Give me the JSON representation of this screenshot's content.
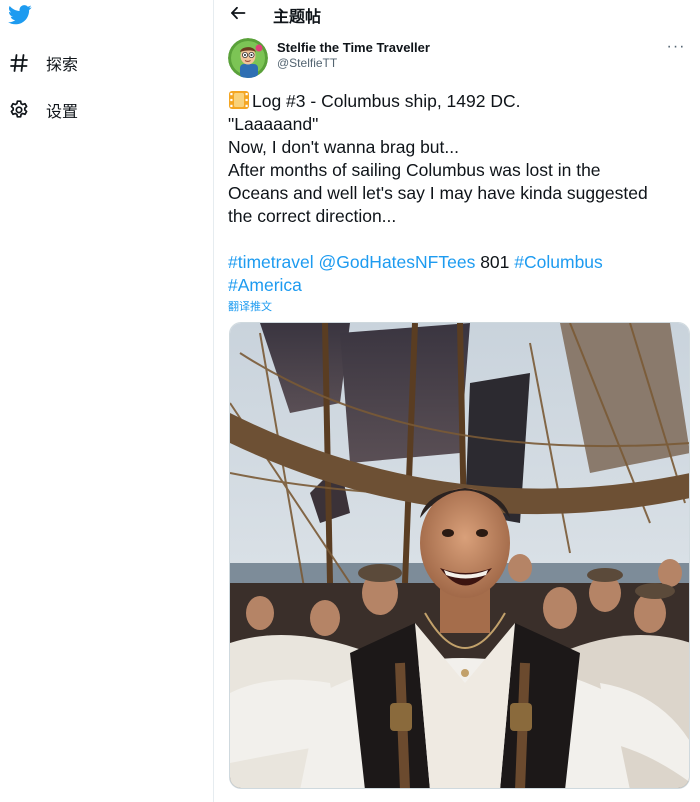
{
  "sidebar": {
    "logo_icon": "twitter-bird-icon",
    "items": [
      {
        "icon": "hashtag-icon",
        "label": "探索"
      },
      {
        "icon": "gear-icon",
        "label": "设置"
      }
    ]
  },
  "header": {
    "back_icon": "back-arrow-icon",
    "title": "主题帖"
  },
  "tweet": {
    "author_name": "Stelfie the Time Traveller",
    "author_handle": "@StelfieTT",
    "more_icon": "more-dots-icon",
    "more_label": "···",
    "emoji": "film-frames-emoji",
    "lines": [
      "Log #3 - Columbus ship, 1492 DC.",
      "\"Laaaaand\"",
      "Now, I don't wanna brag but...",
      "After months of sailing Columbus was lost in the",
      "Oceans and well let's say I may have kinda suggested",
      "the correct direction..."
    ],
    "hashtag_timetravel": "#timetravel",
    "mention": "@GodHatesNFTees",
    "number": " 801 ",
    "hashtag_columbus": "#Columbus",
    "hashtag_america": "#America",
    "translate_label": "翻译推文"
  },
  "colors": {
    "accent": "#1d9bf0",
    "text": "#0f1419",
    "secondary": "#536471",
    "border": "#e6ecf0"
  }
}
